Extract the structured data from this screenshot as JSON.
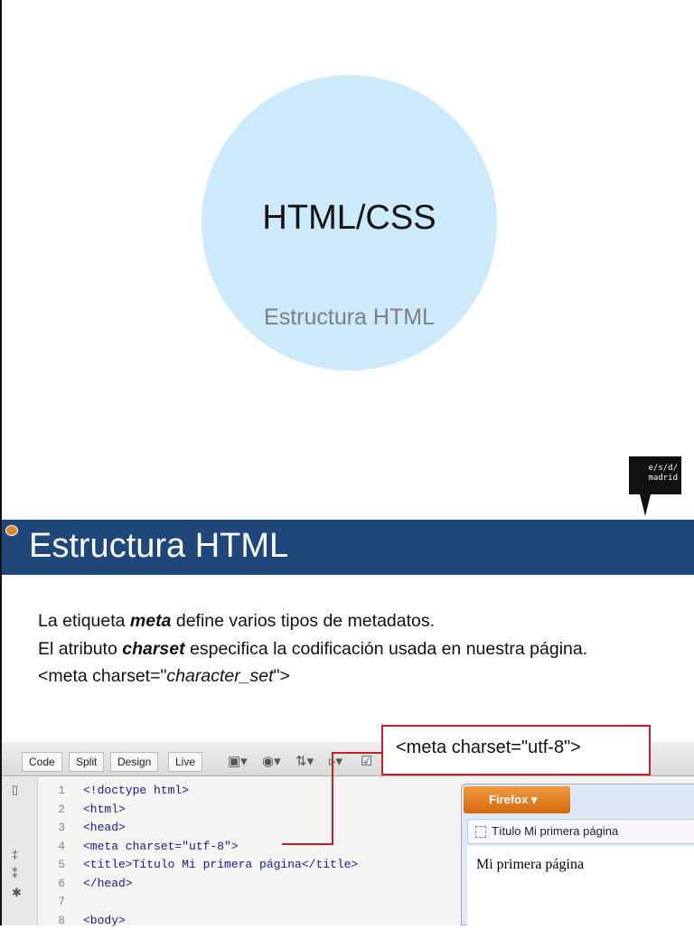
{
  "slide1": {
    "title": "HTML/CSS",
    "subtitle": "Estructura HTML",
    "logo_line1": "e/s/d/",
    "logo_line2": "madrid"
  },
  "slide2": {
    "title": "Estructura HTML",
    "p1_pre": "La etiqueta ",
    "p1_em": "meta",
    "p1_post": " define varios tipos de metadatos.",
    "p2_pre": "El atributo ",
    "p2_em": "charset",
    "p2_post": " especifica la codificación usada en nuestra página.",
    "p3_pre": "<meta charset=\"",
    "p3_em": "character_set",
    "p3_post": "\">",
    "callout": "<meta charset=\"utf-8\">"
  },
  "editor": {
    "views": [
      "Code",
      "Split",
      "Design",
      "Live"
    ],
    "lines": [
      {
        "n": "1",
        "t": "<!doctype html>"
      },
      {
        "n": "2",
        "t": "<html>"
      },
      {
        "n": "3",
        "t": "<head>"
      },
      {
        "n": "4",
        "t": "<meta charset=\"utf-8\">"
      },
      {
        "n": "5",
        "t": "<title>Título Mi primera página</title>"
      },
      {
        "n": "6",
        "t": "</head>"
      },
      {
        "n": "7",
        "t": ""
      },
      {
        "n": "8",
        "t": "<body>"
      }
    ]
  },
  "browser": {
    "menu": "Firefox ▾",
    "tab": "Título Mi primera página",
    "content": "Mi primera página"
  }
}
